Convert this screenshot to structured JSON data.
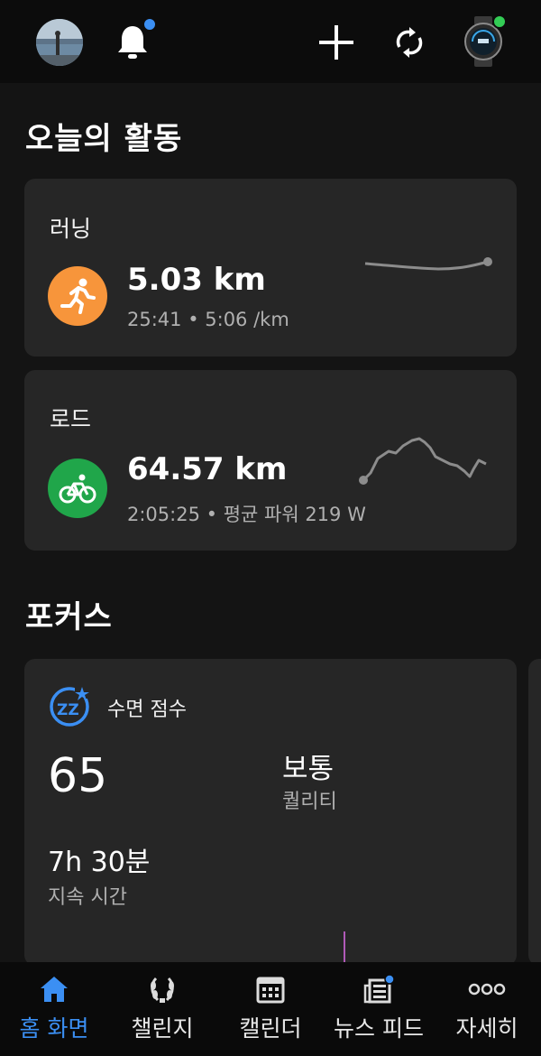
{
  "header": {
    "avatar_icon": "profile-photo",
    "notification_icon": "bell-icon",
    "add_icon": "plus-icon",
    "sync_icon": "sync-icon",
    "device_icon": "watch-icon",
    "accent_dot_color": "#3b8ff3",
    "device_dot_color": "#33cc55"
  },
  "today": {
    "title": "오늘의 활동",
    "activities": [
      {
        "name": "러닝",
        "distance": "5.03 km",
        "detail": "25:41 • 5:06 /km",
        "icon": "running-icon",
        "icon_color": "#f7953b"
      },
      {
        "name": "로드",
        "distance": "64.57 km",
        "detail": "2:05:25 • 평균 파워 219 W",
        "icon": "cycling-icon",
        "icon_color": "#20a64a"
      }
    ]
  },
  "focus": {
    "title": "포커스",
    "sleep": {
      "icon": "sleep-icon",
      "label": "수면 점수",
      "score": "65",
      "quality_value": "보통",
      "quality_label": "퀄리티",
      "duration_value": "7h 30분",
      "duration_label": "지속 시간"
    }
  },
  "nav": {
    "active": "home",
    "active_color": "#3b8ff3",
    "items": [
      {
        "label": "홈 화면",
        "icon": "home-icon"
      },
      {
        "label": "챌린지",
        "icon": "laurel-icon"
      },
      {
        "label": "캘린더",
        "icon": "calendar-icon"
      },
      {
        "label": "뉴스 피드",
        "icon": "newsfeed-icon"
      },
      {
        "label": "자세히",
        "icon": "more-icon"
      }
    ]
  }
}
